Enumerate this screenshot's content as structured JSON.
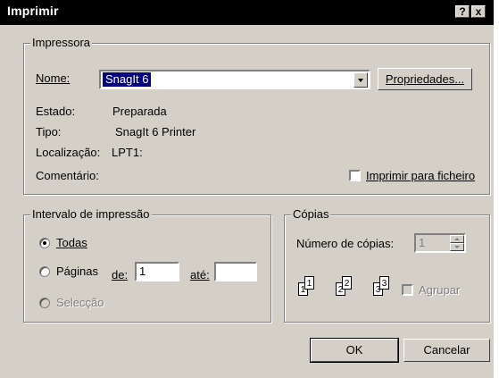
{
  "window": {
    "title": "Imprimir",
    "help_button": "?",
    "close_button": "x"
  },
  "printer_group": {
    "label": "Impressora",
    "name_label": "Nome:",
    "name_value": "SnagIt 6",
    "properties_button": "Propriedades...",
    "status_label": "Estado:",
    "status_value": "Preparada",
    "type_label": "Tipo:",
    "type_value": "SnagIt 6 Printer",
    "location_label": "Localização:",
    "location_value": "LPT1:",
    "comment_label": "Comentário:",
    "print_to_file_label": "Imprimir para ficheiro",
    "print_to_file_checked": false
  },
  "range_group": {
    "label": "Intervalo de impressão",
    "all_label": "Todas",
    "pages_label": "Páginas",
    "from_label": "de:",
    "from_value": "1",
    "to_label": "até:",
    "to_value": "",
    "selection_label": "Selecção",
    "selected": "all"
  },
  "copies_group": {
    "label": "Cópias",
    "count_label": "Número de cópias:",
    "count_value": "1",
    "collate_label": "Agrupar",
    "collate_checked": false,
    "icon_pages": [
      "1",
      "1",
      "2",
      "2",
      "3",
      "3"
    ]
  },
  "buttons": {
    "ok": "OK",
    "cancel": "Cancelar"
  },
  "colors": {
    "titlebar": "#000000",
    "dialog": "#d4d0c8",
    "selection": "#000080"
  }
}
